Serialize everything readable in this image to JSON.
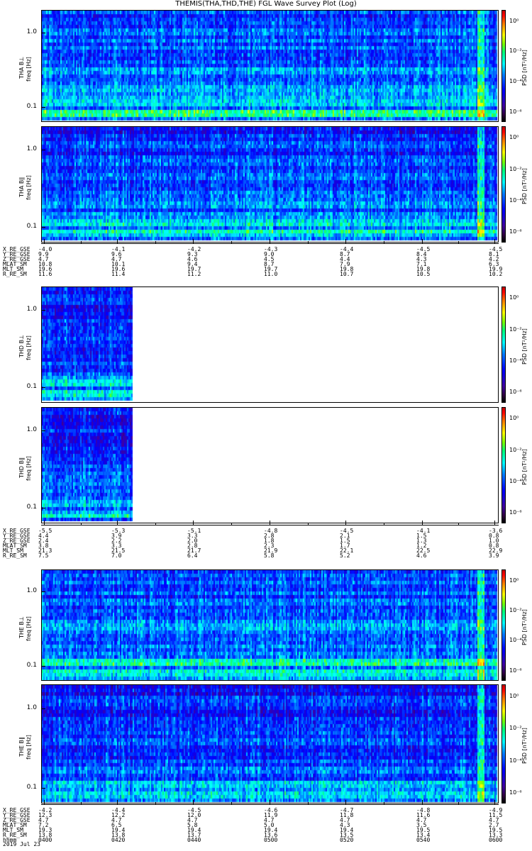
{
  "title": "THEMIS(THA,THD,THE) FGL Wave Survey Plot (Log)",
  "colors": {
    "axis": "#000000",
    "background": "#ffffff"
  },
  "chart_data": {
    "type": "heatmap",
    "title": "THEMIS(THA,THD,THE) FGL Wave Survey Plot (Log)",
    "ylabel": "freq [Hz]",
    "yscale": "log",
    "ylim": [
      0.063,
      2.0
    ],
    "yticks": [
      "1.0",
      "0.1"
    ],
    "colorbar": {
      "label": "PSD [nT²/Hz]",
      "range": [
        1e-07,
        10
      ],
      "scale": "log",
      "ticks": [
        "10⁰",
        "10⁻²",
        "10⁻⁴",
        "10⁻⁶"
      ]
    },
    "xlabel": "hhmm",
    "date": "2019 Jul 23",
    "xticks": [
      "0400",
      "0420",
      "0440",
      "0500",
      "0520",
      "0540",
      "0600"
    ],
    "panels": [
      {
        "probe": "THA",
        "label": "THA B⊥",
        "data_coverage": [
          0,
          1
        ],
        "level": 0.45
      },
      {
        "probe": "THA",
        "label": "THA B∥",
        "data_coverage": [
          0,
          1
        ],
        "level": 0.42
      },
      {
        "probe": "THD",
        "label": "THD B⊥",
        "data_coverage": [
          0,
          0.2
        ],
        "level": 0.4
      },
      {
        "probe": "THD",
        "label": "THD B∥",
        "data_coverage": [
          0,
          0.2
        ],
        "level": 0.4
      },
      {
        "probe": "THE",
        "label": "THE B⊥",
        "data_coverage": [
          0,
          1
        ],
        "level": 0.45
      },
      {
        "probe": "THE",
        "label": "THE B∥",
        "data_coverage": [
          0,
          1
        ],
        "level": 0.4
      }
    ],
    "orbit_tables": [
      {
        "probe": "THA",
        "rows": [
          {
            "name": "X_RE_GSE",
            "values": [
              "-4.0",
              "-4.1",
              "-4.2",
              "-4.3",
              "-4.4",
              "-4.5",
              "-4.5"
            ]
          },
          {
            "name": "Y_RE_GSE",
            "values": [
              "9.9",
              "9.6",
              "9.3",
              "9.0",
              "8.7",
              "8.4",
              "8.1"
            ]
          },
          {
            "name": "Z_RE_GSE",
            "values": [
              "4.7",
              "4.7",
              "4.6",
              "4.5",
              "4.4",
              "4.3",
              "4.2"
            ]
          },
          {
            "name": "MLAT_SM",
            "values": [
              "10.8",
              "10.1",
              "9.4",
              "8.7",
              "7.9",
              "7.1",
              "6.3"
            ]
          },
          {
            "name": "MLT_SM",
            "values": [
              "19.6",
              "19.6",
              "19.7",
              "19.7",
              "19.8",
              "19.8",
              "19.9"
            ]
          },
          {
            "name": "R_RE_SM",
            "values": [
              "11.6",
              "11.4",
              "11.2",
              "11.0",
              "10.7",
              "10.5",
              "10.2"
            ]
          }
        ]
      },
      {
        "probe": "THD",
        "rows": [
          {
            "name": "X_RE_GSE",
            "values": [
              "-5.5",
              "-5.3",
              "-5.1",
              "-4.8",
              "-4.5",
              "-4.1",
              "-3.6"
            ]
          },
          {
            "name": "Y_RE_GSE",
            "values": [
              "4.4",
              "3.9",
              "3.3",
              "2.8",
              "2.1",
              "1.5",
              "0.8"
            ]
          },
          {
            "name": "Z_RE_GSE",
            "values": [
              "2.4",
              "2.2",
              "2.0",
              "1.8",
              "1.5",
              "1.3",
              "1.0"
            ]
          },
          {
            "name": "MLAT_SM",
            "values": [
              "3.8",
              "3.3",
              "2.8",
              "2.3",
              "1.7",
              "1.2",
              "0.8"
            ]
          },
          {
            "name": "MLT_SM",
            "values": [
              "21.3",
              "21.5",
              "21.7",
              "21.9",
              "22.1",
              "22.5",
              "22.9"
            ]
          },
          {
            "name": "R_RE_SM",
            "values": [
              "7.5",
              "7.0",
              "6.4",
              "5.8",
              "5.2",
              "4.6",
              "3.9"
            ]
          }
        ]
      },
      {
        "probe": "THE",
        "rows": [
          {
            "name": "X_RE_GSE",
            "values": [
              "-4.2",
              "-4.4",
              "-4.5",
              "-4.6",
              "-4.7",
              "-4.8",
              "-4.9"
            ]
          },
          {
            "name": "Y_RE_GSE",
            "values": [
              "12.3",
              "12.2",
              "12.0",
              "11.9",
              "11.8",
              "11.6",
              "11.5"
            ]
          },
          {
            "name": "Z_RE_GSE",
            "values": [
              "4.7",
              "4.7",
              "4.7",
              "4.7",
              "4.7",
              "4.7",
              "4.7"
            ]
          },
          {
            "name": "MLAT_SM",
            "values": [
              "7.2",
              "6.5",
              "5.8",
              "5.0",
              "4.3",
              "3.5",
              "2.7"
            ]
          },
          {
            "name": "MLT_SM",
            "values": [
              "19.3",
              "19.4",
              "19.4",
              "19.4",
              "19.4",
              "19.5",
              "19.5"
            ]
          },
          {
            "name": "R_RE_SM",
            "values": [
              "13.8",
              "13.8",
              "13.7",
              "13.6",
              "13.5",
              "13.4",
              "13.3"
            ]
          },
          {
            "name": "hhmm",
            "values": [
              "0400",
              "0420",
              "0440",
              "0500",
              "0520",
              "0540",
              "0600"
            ]
          }
        ]
      }
    ]
  }
}
